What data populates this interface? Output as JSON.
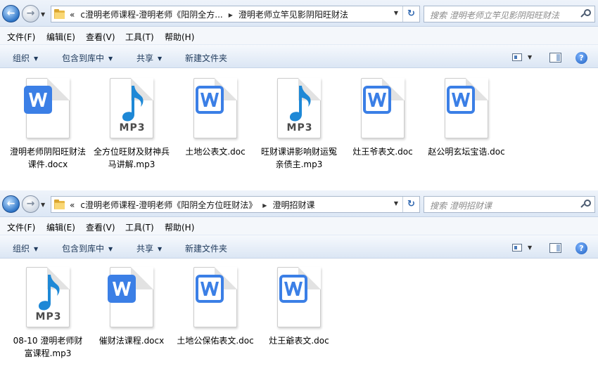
{
  "windows": [
    {
      "breadcrumb": [
        "«",
        "c澄明老师课程-澄明老师《阳阴全方...",
        "澄明老师立竿见影阴阳旺财法"
      ],
      "search_placeholder": "搜索 澄明老师立竿见影阴阳旺财法",
      "menu": [
        "文件(F)",
        "编辑(E)",
        "查看(V)",
        "工具(T)",
        "帮助(H)"
      ],
      "toolbar": [
        "组织",
        "包含到库中",
        "共享",
        "新建文件夹"
      ],
      "files": [
        {
          "type": "docx",
          "name": "澄明老师阴阳旺财法课件.docx"
        },
        {
          "type": "mp3",
          "name": "全方位旺财及财神兵马讲解.mp3"
        },
        {
          "type": "doc",
          "name": "土地公表文.doc"
        },
        {
          "type": "mp3",
          "name": "旺财课讲影响财运冤亲债主.mp3"
        },
        {
          "type": "doc",
          "name": "灶王爷表文.doc"
        },
        {
          "type": "doc",
          "name": "赵公明玄坛宝诰.doc"
        }
      ]
    },
    {
      "breadcrumb": [
        "«",
        "c澄明老师课程-澄明老师《阳阴全方位旺财法》",
        "澄明招财课"
      ],
      "search_placeholder": "搜索 澄明招财课",
      "menu": [
        "文件(F)",
        "编辑(E)",
        "查看(V)",
        "工具(T)",
        "帮助(H)"
      ],
      "toolbar": [
        "组织",
        "包含到库中",
        "共享",
        "新建文件夹"
      ],
      "files": [
        {
          "type": "mp3",
          "name": "08-10 澄明老师财富课程.mp3"
        },
        {
          "type": "docx",
          "name": "催财法课程.docx"
        },
        {
          "type": "doc",
          "name": "土地公保佑表文.doc"
        },
        {
          "type": "doc",
          "name": "灶王爺表文.doc"
        }
      ]
    }
  ],
  "colors": {
    "word_blue": "#3b7fe6",
    "music_blue": "#1e88d6"
  },
  "icons": {
    "back": "back-arrow-icon",
    "forward": "forward-arrow-icon",
    "folder": "folder-icon",
    "refresh": "refresh-icon",
    "search": "search-icon",
    "help": "help-icon",
    "word": "word-document-icon",
    "mp3": "music-note-icon"
  }
}
